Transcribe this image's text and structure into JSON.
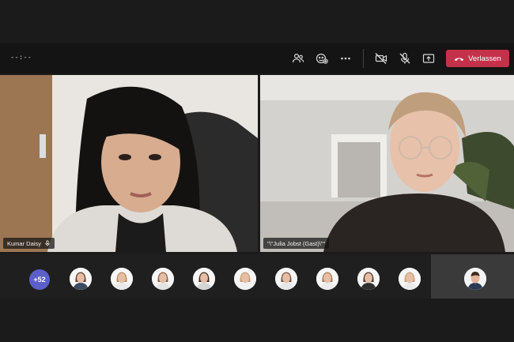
{
  "topbar": {
    "timer": "--:--",
    "leave_label": "Verlassen",
    "leave_color": "#c4314b",
    "icons": [
      "participants-icon",
      "reactions-icon",
      "more-options-icon",
      "camera-off-icon",
      "mic-off-icon",
      "share-screen-icon"
    ]
  },
  "video_tiles": [
    {
      "name": "Kumar Daisy"
    },
    {
      "name": "\"\\\"Julia Jobst (Gast)\\\"\""
    }
  ],
  "participant_strip": {
    "more_count": "+52",
    "avatar_count": 10,
    "accent": "#5b5fc7"
  }
}
